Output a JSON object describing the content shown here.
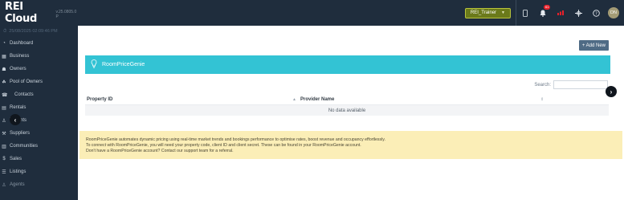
{
  "app": {
    "brand": "REI Cloud",
    "version": "v.25.0805.0 P",
    "accent_color": "#33c3d4",
    "sidebar_color": "#1f2d3d"
  },
  "topbar": {
    "trainer_button": "REI_Trainer",
    "trainer_caret": "▼",
    "notification_count": "61",
    "avatar_initials": "DN",
    "icons": [
      "phone-icon",
      "bell-icon",
      "signal-icon",
      "grid-icon",
      "help-icon"
    ]
  },
  "sidebar": {
    "datetime": "25/08/2025 02:09:46 PM",
    "items": [
      {
        "label": "Dashboard",
        "icon": "dashboard-icon"
      },
      {
        "label": "Business",
        "icon": "business-icon"
      },
      {
        "label": "Owners",
        "icon": "owners-icon"
      },
      {
        "label": "Pool of Owners",
        "icon": "pool-icon"
      },
      {
        "label": "Contacts",
        "icon": "contacts-icon"
      },
      {
        "label": "Rentals",
        "icon": "rentals-icon"
      },
      {
        "label": "Tenants",
        "icon": "tenants-icon"
      },
      {
        "label": "Suppliers",
        "icon": "suppliers-icon"
      },
      {
        "label": "Communities",
        "icon": "communities-icon"
      },
      {
        "label": "Sales",
        "icon": "sales-icon"
      },
      {
        "label": "Listings",
        "icon": "listings-icon"
      },
      {
        "label": "Agents",
        "icon": "agents-icon"
      }
    ]
  },
  "main": {
    "add_button": "+ Add New",
    "banner_title": "RoomPriceGenie",
    "search_label": "Search:",
    "search_value": "",
    "columns": [
      "Property ID",
      "Provider Name"
    ],
    "empty_message": "No data available",
    "info_lines": [
      "RoomPriceGenie automates dynamic pricing using real-time market trends and bookings performance to optimise rates, boost revenue and occupancy effortlessly.",
      "To connect with RoomPriceGenie, you will need your property code, client ID and client secret. These can be found in your RoomPriceGenie account.",
      "Don't have a RoomPriceGenie account? Contact our support team for a referral."
    ]
  }
}
